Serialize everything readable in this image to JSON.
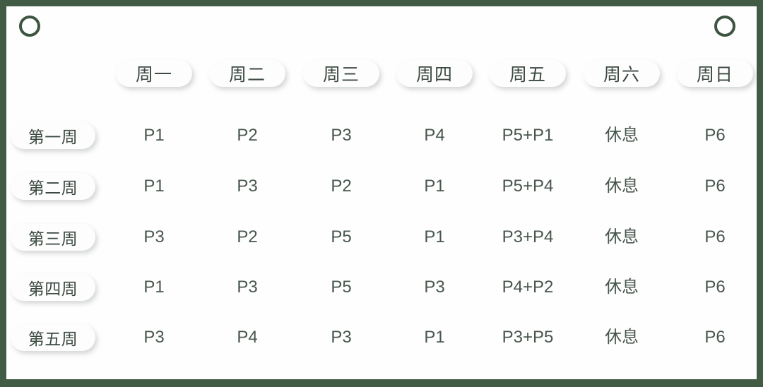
{
  "decor": {
    "punch_hole_left": "circle-ring",
    "punch_hole_right": "circle-ring",
    "border_color": "#415b44",
    "card_color": "#fefefe",
    "text_color": "#48574d",
    "pill_color": "#fdfdfd"
  },
  "table": {
    "corner_label": "",
    "day_headers": [
      "周一",
      "周二",
      "周三",
      "周四",
      "周五",
      "周六",
      "周日"
    ],
    "week_labels": [
      "第一周",
      "第二周",
      "第三周",
      "第四周",
      "第五周"
    ],
    "rows": [
      [
        "P1",
        "P2",
        "P3",
        "P4",
        "P5+P1",
        "休息",
        "P6"
      ],
      [
        "P1",
        "P3",
        "P2",
        "P1",
        "P5+P4",
        "休息",
        "P6"
      ],
      [
        "P3",
        "P2",
        "P5",
        "P1",
        "P3+P4",
        "休息",
        "P6"
      ],
      [
        "P1",
        "P3",
        "P5",
        "P3",
        "P4+P2",
        "休息",
        "P6"
      ],
      [
        "P3",
        "P4",
        "P3",
        "P1",
        "P3+P5",
        "休息",
        "P6"
      ]
    ]
  }
}
